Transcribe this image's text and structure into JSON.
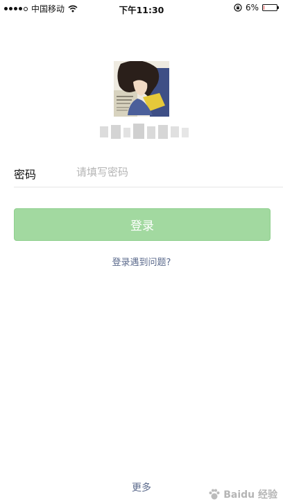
{
  "status_bar": {
    "carrier": "中国移动",
    "time": "下午11:30",
    "battery_percent": "6%",
    "battery_level": 0.06,
    "battery_color": "#e53935",
    "icons": [
      "signal-dots-icon",
      "wifi-icon",
      "rotation-lock-icon",
      "battery-icon"
    ]
  },
  "login": {
    "password_label": "密码",
    "password_placeholder": "请填写密码",
    "login_button_label": "登录",
    "trouble_link": "登录遇到问题?",
    "more_link": "更多"
  },
  "colors": {
    "login_button_bg": "#a2d9a0",
    "link_color": "#5b6a8c"
  },
  "watermark": {
    "text": "Baidu 经验"
  }
}
